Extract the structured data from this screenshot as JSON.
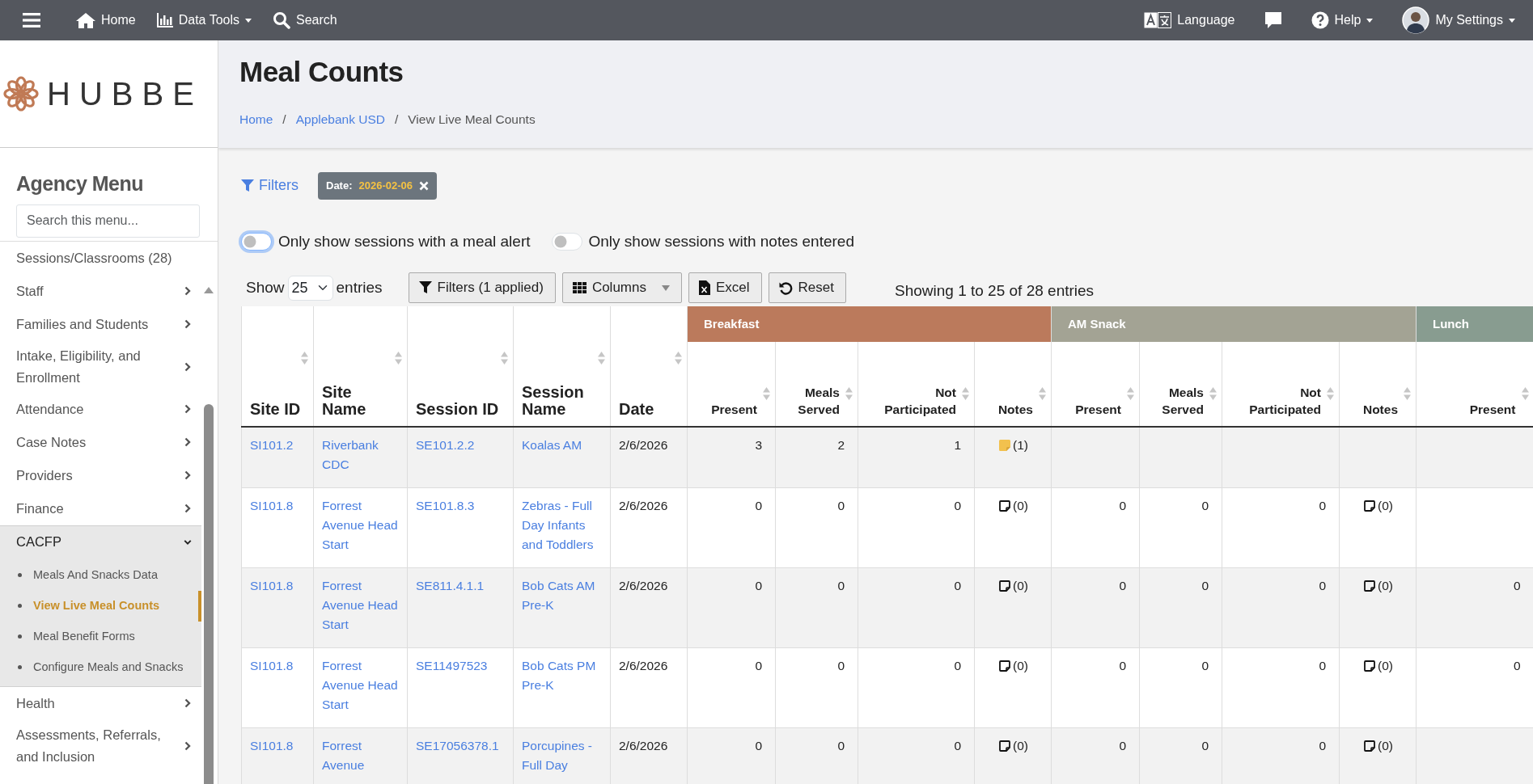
{
  "topbar": {
    "left": [
      {
        "kind": "home",
        "label": "Home",
        "dropdown": false
      },
      {
        "kind": "chart",
        "label": "Data Tools",
        "dropdown": true
      },
      {
        "kind": "search",
        "label": "Search",
        "dropdown": false
      }
    ],
    "right": [
      {
        "kind": "language",
        "label": "Language",
        "dropdown": false
      },
      {
        "kind": "chat"
      },
      {
        "kind": "help",
        "label": "Help",
        "dropdown": true
      },
      {
        "kind": "avatar",
        "label": "My Settings",
        "dropdown": true
      }
    ]
  },
  "sidebar": {
    "logo": "HUBBE",
    "heading": "Agency Menu",
    "search_placeholder": "Search this menu...",
    "items": [
      {
        "kind": "link",
        "label": "Sessions/Classrooms (28)"
      },
      {
        "kind": "group",
        "label": "Staff",
        "expanded": false
      },
      {
        "kind": "group",
        "label": "Families and Students",
        "expanded": false
      },
      {
        "kind": "group",
        "label": "Intake, Eligibility, and Enrollment",
        "expanded": false
      },
      {
        "kind": "group",
        "label": "Attendance",
        "expanded": false
      },
      {
        "kind": "group",
        "label": "Case Notes",
        "expanded": false
      },
      {
        "kind": "group",
        "label": "Providers",
        "expanded": false
      },
      {
        "kind": "group",
        "label": "Finance",
        "expanded": false
      },
      {
        "kind": "group",
        "label": "CACFP",
        "expanded": true,
        "children": [
          {
            "label": "Meals And Snacks Data",
            "selected": false
          },
          {
            "label": "View Live Meal Counts",
            "selected": true
          },
          {
            "label": "Meal Benefit Forms",
            "selected": false
          },
          {
            "label": "Configure Meals and Snacks",
            "selected": false
          }
        ]
      },
      {
        "kind": "group",
        "label": "Health",
        "expanded": false
      },
      {
        "kind": "group",
        "label": "Assessments, Referrals, and Inclusion",
        "expanded": false
      }
    ]
  },
  "page": {
    "title": "Meal Counts",
    "separator": "/",
    "breadcrumb": [
      {
        "label": "Home",
        "link": true
      },
      {
        "label": "Applebank USD",
        "link": true
      },
      {
        "label": "View Live Meal Counts",
        "link": false
      }
    ]
  },
  "filters": {
    "label": "Filters",
    "chips": [
      {
        "key": "Date:",
        "value": "2026-02-06"
      }
    ]
  },
  "toggles": [
    {
      "label": "Only show sessions with a meal alert",
      "on": false,
      "focused": true
    },
    {
      "label": "Only show sessions with notes entered",
      "on": false,
      "focused": false
    }
  ],
  "length": {
    "before": "Show",
    "value": "25",
    "after": "entries"
  },
  "buttons": [
    {
      "kind": "filter",
      "label": "Filters (1 applied)",
      "dropdown": false
    },
    {
      "kind": "columns",
      "label": "Columns",
      "dropdown": true
    },
    {
      "kind": "excel",
      "label": "Excel",
      "dropdown": false
    },
    {
      "kind": "reset",
      "label": "Reset",
      "dropdown": false
    }
  ],
  "info": "Showing 1 to 25 of 28 entries",
  "table": {
    "columns": [
      "Site ID",
      "Site Name",
      "Session ID",
      "Session Name",
      "Date"
    ],
    "groups": [
      {
        "label": "Breakfast",
        "color": "#bb7a5c",
        "columns": [
          "Present",
          "Meals Served",
          "Not Participated",
          "Notes"
        ]
      },
      {
        "label": "AM Snack",
        "color": "#a3a394",
        "columns": [
          "Present",
          "Meals Served",
          "Not Participated",
          "Notes"
        ]
      },
      {
        "label": "Lunch",
        "color": "#889c90",
        "columns": [
          "Present"
        ]
      }
    ],
    "rows": [
      {
        "site_id": "SI101.2",
        "site_name": "Riverbank CDC",
        "session_id": "SE101.2.2",
        "session_name": "Koalas AM",
        "date": "2/6/2026",
        "breakfast": {
          "present": "3",
          "served": "2",
          "not_participated": "1",
          "notes": "(1)",
          "notes_filled": true
        }
      },
      {
        "site_id": "SI101.8",
        "site_name": "Forrest Avenue Head Start",
        "session_id": "SE101.8.3",
        "session_name": "Zebras - Full Day Infants and Toddlers",
        "date": "2/6/2026",
        "breakfast": {
          "present": "0",
          "served": "0",
          "not_participated": "0",
          "notes": "(0)",
          "notes_filled": false
        },
        "am_snack": {
          "present": "0",
          "served": "0",
          "not_participated": "0",
          "notes": "(0)",
          "notes_filled": false
        }
      },
      {
        "site_id": "SI101.8",
        "site_name": "Forrest Avenue Head Start",
        "session_id": "SE811.4.1.1",
        "session_name": "Bob Cats AM Pre-K",
        "date": "2/6/2026",
        "breakfast": {
          "present": "0",
          "served": "0",
          "not_participated": "0",
          "notes": "(0)",
          "notes_filled": false
        },
        "am_snack": {
          "present": "0",
          "served": "0",
          "not_participated": "0",
          "notes": "(0)",
          "notes_filled": false
        },
        "lunch": {
          "present": "0"
        }
      },
      {
        "site_id": "SI101.8",
        "site_name": "Forrest Avenue Head Start",
        "session_id": "SE11497523",
        "session_name": "Bob Cats PM Pre-K",
        "date": "2/6/2026",
        "breakfast": {
          "present": "0",
          "served": "0",
          "not_participated": "0",
          "notes": "(0)",
          "notes_filled": false
        },
        "am_snack": {
          "present": "0",
          "served": "0",
          "not_participated": "0",
          "notes": "(0)",
          "notes_filled": false
        },
        "lunch": {
          "present": "0"
        }
      },
      {
        "site_id": "SI101.8",
        "site_name": "Forrest Avenue",
        "session_id": "SE17056378.1",
        "session_name": "Porcupines - Full Day",
        "date": "2/6/2026",
        "breakfast": {
          "present": "0",
          "served": "0",
          "not_participated": "0",
          "notes": "(0)",
          "notes_filled": false
        },
        "am_snack": {
          "present": "0",
          "served": "0",
          "not_participated": "0",
          "notes": "(0)",
          "notes_filled": false
        }
      }
    ]
  }
}
